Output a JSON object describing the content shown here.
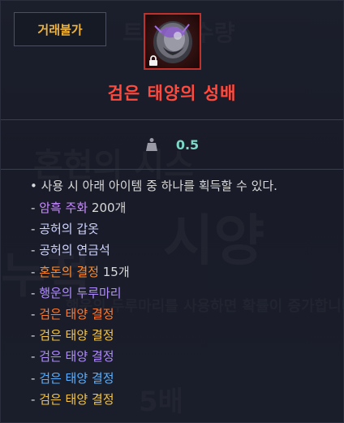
{
  "tooltip": {
    "trade_badge": "거래불가",
    "item_name": "검은 태양의 성배",
    "weight_value": "0.5",
    "description": "사용 시 아래 아이템 중 하나를 획득할 수 있다.",
    "rewards": [
      {
        "name": "암흑 주화",
        "qty": "200개",
        "color": "#c98cff"
      },
      {
        "name": "공허의 갑옷",
        "qty": "",
        "color": "#cfd4ff"
      },
      {
        "name": "공허의 연금석",
        "qty": "",
        "color": "#cfd4ff"
      },
      {
        "name": "혼돈의 결정",
        "qty": "15개",
        "color": "#ff8a2a"
      },
      {
        "name": "행운의 두루마리",
        "qty": "",
        "color": "#b08cff"
      },
      {
        "name": "검은 태양 결정",
        "qty": "",
        "color": "#ff7a2a"
      },
      {
        "name": "검은 태양 결정",
        "qty": "",
        "color": "#f5c542"
      },
      {
        "name": "검은 태양 결정",
        "qty": "",
        "color": "#b08cff"
      },
      {
        "name": "검은 태양 결정",
        "qty": "",
        "color": "#5ab0ff"
      },
      {
        "name": "검은 태양 결정",
        "qty": "",
        "color": "#f5c542"
      }
    ],
    "colors": {
      "item_name": "#ff4a3e",
      "trade_badge": "#f0b338",
      "weight": "#7dd6c8",
      "icon_border": "#c0312c"
    }
  }
}
